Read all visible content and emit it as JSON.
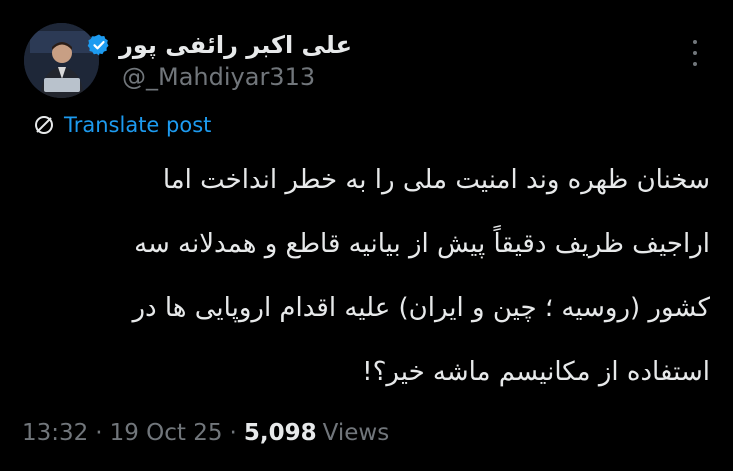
{
  "post": {
    "author": {
      "display_name": "علی اکبر رائفی پور",
      "handle": "@_Mahdiyar313",
      "verified_icon": "verified-badge-icon",
      "avatar_icon": "avatar-photo"
    },
    "more_icon": "more-options-icon",
    "translate": {
      "icon": "translate-icon",
      "label": "Translate post"
    },
    "text_lines": [
      "سخنان ظهره وند امنیت ملی را به خطر انداخت اما",
      "اراجیف ظریف دقیقاً پیش از بیانیه قاطع و همدلانه سه",
      "کشور (روسیه ؛ چین و ایران) علیه اقدام اروپایی ها در",
      "استفاده از مکانیسم ماشه خیر؟!"
    ],
    "meta": {
      "time": "13:32",
      "separator": "·",
      "date": "19 Oct 25",
      "views_count": "5,098",
      "views_label": "Views"
    }
  },
  "colors": {
    "background": "#000000",
    "text": "#e7e9ea",
    "secondary": "#71767b",
    "accent": "#1d9bf0"
  }
}
